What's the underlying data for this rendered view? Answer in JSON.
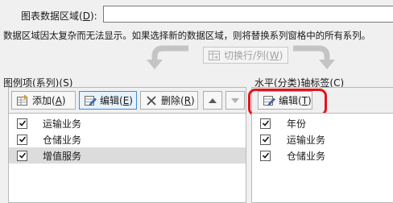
{
  "data_range": {
    "label": "图表数据区域",
    "key": "D",
    "value": ""
  },
  "warning": "数据区域因太复杂而无法显示。如果选择新的数据区域，则将替换系列窗格中的所有系列。",
  "switch_button": {
    "label": "切换行/列",
    "key": "W",
    "enabled": false
  },
  "legend_entries": {
    "label": "图例项(系列)",
    "key": "S",
    "add_label": "添加",
    "add_key": "A",
    "edit_label": "编辑",
    "edit_key": "E",
    "delete_label": "删除",
    "delete_key": "R",
    "items": [
      {
        "label": "运输业务",
        "checked": true,
        "selected": false
      },
      {
        "label": "仓储业务",
        "checked": true,
        "selected": false
      },
      {
        "label": "增值服务",
        "checked": true,
        "selected": true
      }
    ]
  },
  "axis_labels": {
    "label": "水平(分类)轴标签",
    "key": "C",
    "edit_label": "编辑",
    "edit_key": "T",
    "items": [
      {
        "label": "年份",
        "checked": true
      },
      {
        "label": "运输业务",
        "checked": true
      },
      {
        "label": "仓储业务",
        "checked": true
      }
    ]
  },
  "colors": {
    "highlight": "#e0141a",
    "accent": "#3b8fd9"
  },
  "icons": [
    "switch-row-column-icon",
    "add-icon",
    "edit-icon",
    "delete-icon",
    "move-up-icon",
    "move-down-icon",
    "checkmark-icon",
    "arrow-left-icon",
    "arrow-right-icon"
  ]
}
